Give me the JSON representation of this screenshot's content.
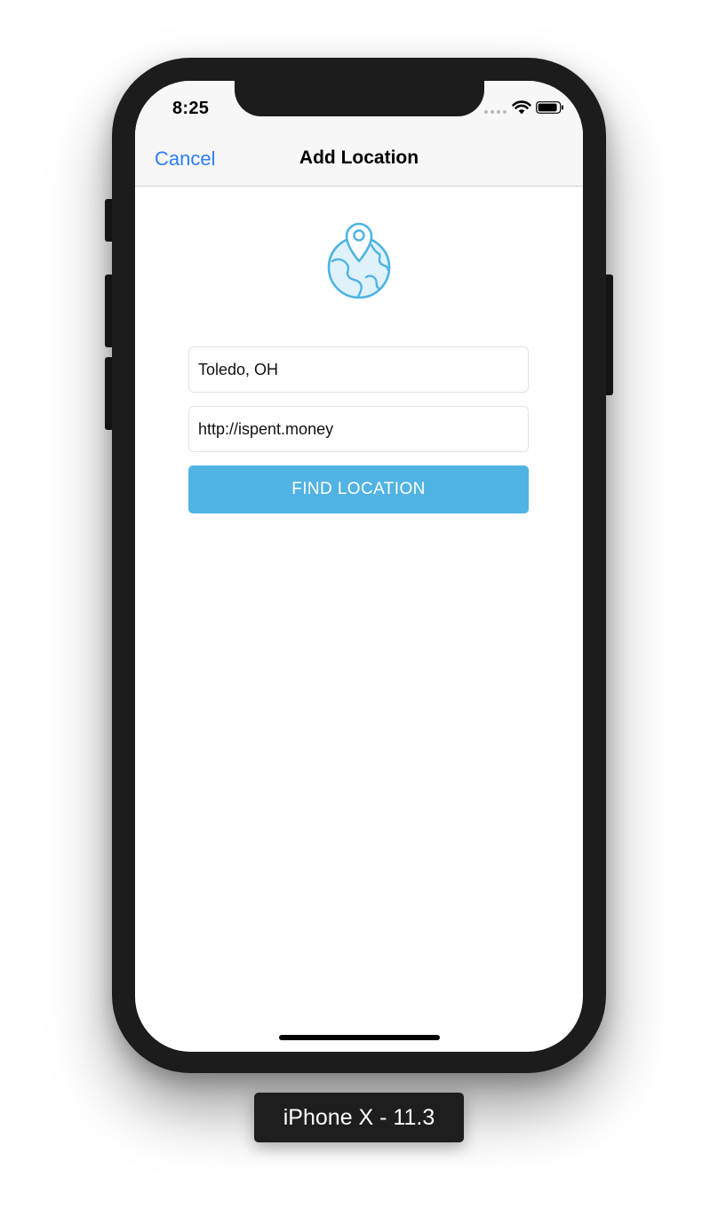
{
  "status_bar": {
    "time": "8:25",
    "icons": [
      "cellular-signal-icon",
      "wifi-icon",
      "battery-icon"
    ]
  },
  "nav_bar": {
    "cancel_label": "Cancel",
    "title": "Add Location"
  },
  "content": {
    "header_icon": "globe-location-pin-icon",
    "location_field": {
      "value": "Toledo, OH"
    },
    "url_field": {
      "value": "http://ispent.money"
    },
    "find_button_label": "FIND LOCATION"
  },
  "device_label": "iPhone X - 11.3",
  "colors": {
    "accent": "#2f7cf6",
    "button": "#51b3e3",
    "icon_stroke": "#4eb4e2",
    "icon_fill": "#dff2fb",
    "device_frame": "#1c1c1c"
  }
}
